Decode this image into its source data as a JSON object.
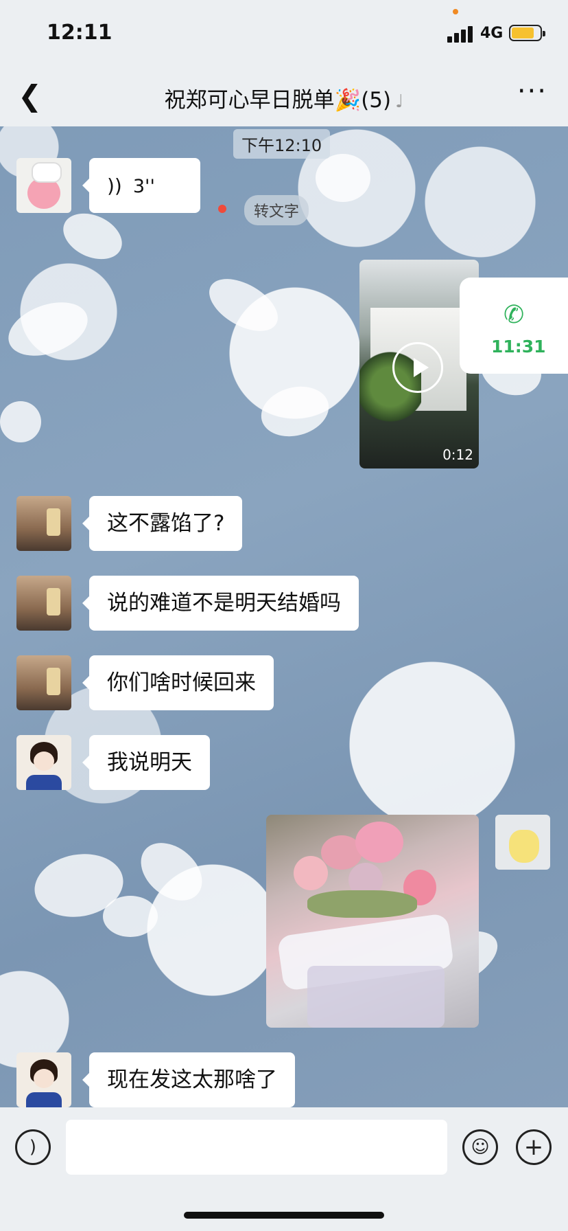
{
  "status_bar": {
    "time": "12:11",
    "network": "4G"
  },
  "nav": {
    "title": "祝郑可心早日脱单🎉(5)"
  },
  "chat": {
    "timestamp": "下午12:10",
    "voice": {
      "duration": "3''",
      "to_text_label": "转文字"
    },
    "video": {
      "duration": "0:12"
    },
    "call": {
      "time": "11:31"
    },
    "messages": [
      {
        "text": "这不露馅了?"
      },
      {
        "text": "说的难道不是明天结婚吗"
      },
      {
        "text": "你们啥时候回来"
      },
      {
        "text": "我说明天"
      },
      {
        "text": "现在发这太那啥了"
      }
    ]
  },
  "colors": {
    "accent_green": "#2fb25b",
    "unread_dot": "#f04a3a",
    "bubble": "#ffffff"
  },
  "icons": [
    "back-chevron-icon",
    "more-dots-icon",
    "ear-icon",
    "voice-wave-icon",
    "play-icon",
    "phone-icon",
    "voice-mode-icon",
    "emoji-icon",
    "plus-icon"
  ]
}
